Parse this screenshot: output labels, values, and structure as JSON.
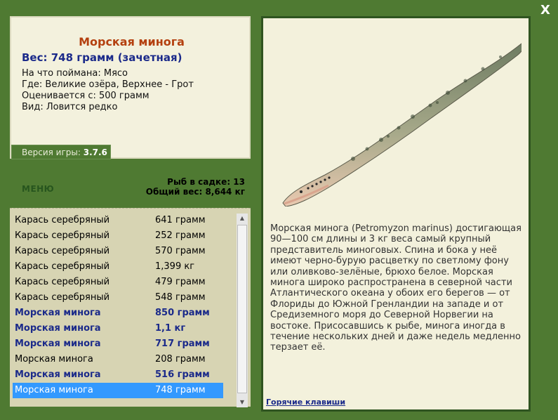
{
  "close_label": "X",
  "fish": {
    "name": "Морская минога",
    "weight": "Вес: 748 грамм (зачетная)",
    "bait": "На что поймана: Мясо",
    "location": "Где: Великие озёра, Верхнее - Грот",
    "value": "Оценивается с: 500 грамм",
    "rarity": "Вид: Ловится редко",
    "image": "sea-lamprey-illustration"
  },
  "version": {
    "label": "Версия игры:",
    "value": "3.7.6"
  },
  "menu_label": "МЕНЮ",
  "cage": {
    "count": "Рыб в садке: 13",
    "total": "Общий вес: 8,644 кг"
  },
  "catch_list": [
    {
      "name": "Карась серебряный",
      "weight": "641 грамм",
      "type": "carp"
    },
    {
      "name": "Карась серебряный",
      "weight": "252 грамм",
      "type": "carp"
    },
    {
      "name": "Карась серебряный",
      "weight": "570 грамм",
      "type": "carp"
    },
    {
      "name": "Карась серебряный",
      "weight": "1,399 кг",
      "type": "carp"
    },
    {
      "name": "Карась серебряный",
      "weight": "479 грамм",
      "type": "carp"
    },
    {
      "name": "Карась серебряный",
      "weight": "548 грамм",
      "type": "carp"
    },
    {
      "name": "Морская минога",
      "weight": "850 грамм",
      "type": "lamprey"
    },
    {
      "name": "Морская минога",
      "weight": "1,1 кг",
      "type": "lamprey"
    },
    {
      "name": "Морская минога",
      "weight": "717 грамм",
      "type": "lamprey"
    },
    {
      "name": "Морская минога",
      "weight": "208 грамм",
      "type": "plain"
    },
    {
      "name": "Морская минога",
      "weight": "516 грамм",
      "type": "lamprey"
    },
    {
      "name": "Морская минога",
      "weight": "748 грамм",
      "type": "selected"
    }
  ],
  "description": "Морская минога (Petromyzon marinus) достигающая 90—100 см длины и 3 кг веса самый крупный представитель миноговых. Спина и бока у неё имеют черно-бурую расцветку по светлому фону или оливково-зелёные, брюхо белое. Морская минога широко распространена в северной части Атлантического океана у обоих его берегов — от Флориды до Южной Гренландии на западе и от Средиземного моря до Северной Норвегии на востоке. Присосавшись к рыбе, минога иногда в течение нескольких дней и даже недель медленно терзает её.",
  "hotkeys_label": "Горячие клавиши",
  "colors": {
    "background": "#4f7a32",
    "panel": "#f3f1dd",
    "accent_blue": "#1b2a8a",
    "title_orange": "#b4400f",
    "selection": "#3399ff"
  }
}
